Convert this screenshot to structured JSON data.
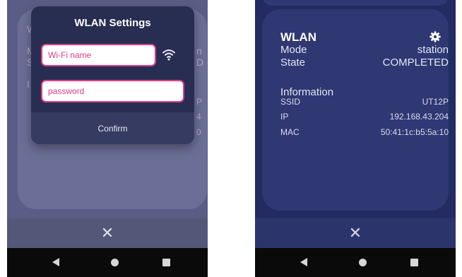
{
  "left_screen": {
    "dialog": {
      "title": "WLAN Settings",
      "ssid_placeholder": "Wi-Fi name",
      "password_placeholder": "password",
      "confirm_label": "Confirm",
      "wifi_icon": "wifi-icon"
    },
    "background_ghost": {
      "title_fragment": "W",
      "mode_fragment": "M",
      "mode_value_fragment": "n",
      "state_fragment": "S",
      "state_value_fragment": "D",
      "info_fragment": "I",
      "ssid_value_fragment": "P",
      "ip_value_fragment": "4",
      "mac_value_fragment": "0"
    },
    "close_label": "✕"
  },
  "right_screen": {
    "card_title": "WLAN",
    "settings_icon": "gear-icon",
    "mode_label": "Mode",
    "mode_value": "station",
    "state_label": "State",
    "state_value": "COMPLETED",
    "info_heading": "Information",
    "ssid_label": "SSID",
    "ssid_value": "UT12P",
    "ip_label": "IP",
    "ip_value": "192.168.43.204",
    "mac_label": "MAC",
    "mac_value": "50:41:1c:b5:5a:10",
    "close_label": "✕"
  },
  "system_nav": {
    "back_icon": "back-icon",
    "home_icon": "home-icon",
    "recents_icon": "recents-icon"
  },
  "colors": {
    "accent_pink": "#e23c86",
    "card_navy": "#2f3873",
    "screen_navy": "#232b62",
    "dialog_bg": "#282e52"
  }
}
